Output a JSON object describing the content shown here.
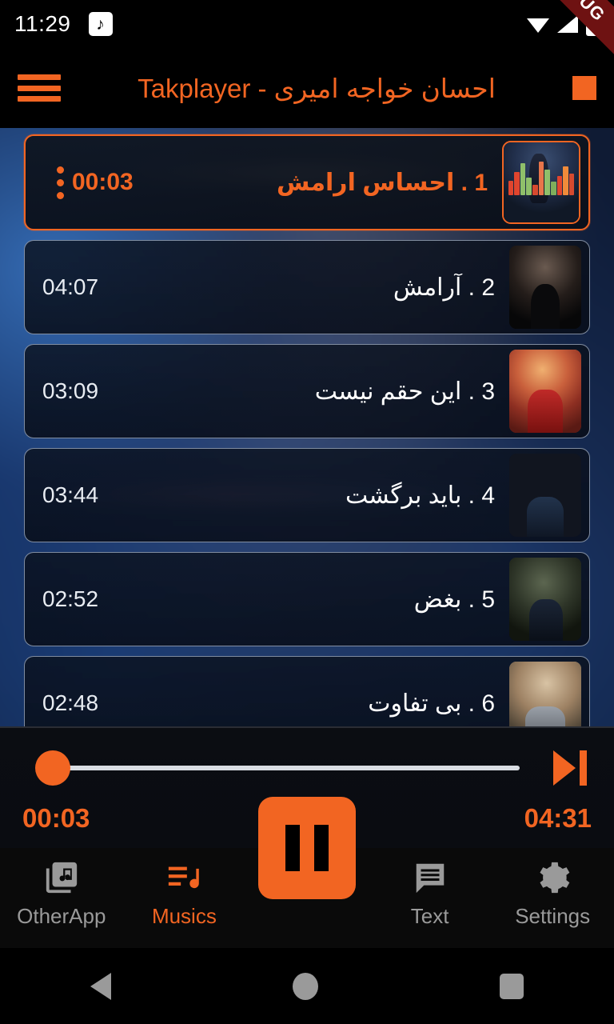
{
  "statusbar": {
    "time": "11:29",
    "music_note_icon": "music-note-icon",
    "wifi_icon": "wifi-icon",
    "signal_icon": "signal-icon",
    "battery_icon": "battery-icon"
  },
  "debug_banner": {
    "label": "DEBUG",
    "color": "#6e1212"
  },
  "appbar": {
    "menu_icon": "hamburger-icon",
    "title": "احسان خواجه امیری - Takplayer",
    "stop_icon": "stop-square-icon",
    "accent": "#f26522"
  },
  "playlist": {
    "tracks": [
      {
        "index": "1",
        "title": "1 . احساس ارامش",
        "duration": "00:03",
        "artwork": "art-1",
        "playing": true,
        "menu_icon": "more-vert-icon"
      },
      {
        "index": "2",
        "title": "2 . آرامش",
        "duration": "04:07",
        "artwork": "art-2",
        "playing": false,
        "menu_icon": "more-vert-icon"
      },
      {
        "index": "3",
        "title": "3 . این حقم نیست",
        "duration": "03:09",
        "artwork": "art-3",
        "playing": false,
        "menu_icon": "more-vert-icon"
      },
      {
        "index": "4",
        "title": "4 . باید برگشت",
        "duration": "03:44",
        "artwork": "art-4",
        "playing": false,
        "menu_icon": "more-vert-icon"
      },
      {
        "index": "5",
        "title": "5 . بغض",
        "duration": "02:52",
        "artwork": "art-5",
        "playing": false,
        "menu_icon": "more-vert-icon"
      },
      {
        "index": "6",
        "title": "6 . بی تفاوت",
        "duration": "02:48",
        "artwork": "art-6",
        "playing": false,
        "menu_icon": "more-vert-icon"
      }
    ],
    "equalizer_bar_colors": [
      "#e0452e",
      "#e0452e",
      "#8fbf6a",
      "#8fbf6a",
      "#d64a2f",
      "#e8754a",
      "#8fbf6a",
      "#7fae5c",
      "#e0452e",
      "#f08b3a",
      "#d64a2f"
    ],
    "equalizer_bar_heights": [
      42,
      70,
      96,
      52,
      30,
      100,
      76,
      40,
      58,
      86,
      64
    ]
  },
  "player": {
    "current_time": "00:03",
    "total_time": "04:31",
    "progress_percent": 1,
    "seek_thumb_icon": "seek-thumb",
    "next_icon": "skip-next-icon",
    "play_pause_icon": "pause-icon",
    "accent": "#f26522"
  },
  "bottomnav": {
    "items": [
      {
        "label": "OtherApp",
        "icon": "library-music-icon",
        "active": false
      },
      {
        "label": "Musics",
        "icon": "queue-music-icon",
        "active": true
      },
      {
        "label": "Text",
        "icon": "comment-text-icon",
        "active": false
      },
      {
        "label": "Settings",
        "icon": "gear-icon",
        "active": false
      }
    ]
  },
  "androidnav": {
    "back_icon": "back-triangle-icon",
    "home_icon": "home-circle-icon",
    "recents_icon": "recents-square-icon"
  }
}
